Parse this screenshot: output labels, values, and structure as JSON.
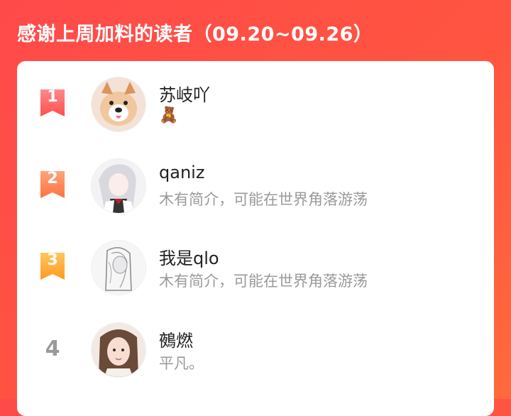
{
  "header": {
    "title": "感谢上周加料的读者（09.20~09.26）"
  },
  "readers": [
    {
      "rank": "1",
      "name": "苏岐吖",
      "bio": "🧸",
      "badge_color": "#ff6a6a"
    },
    {
      "rank": "2",
      "name": "qaniz",
      "bio": "木有简介，可能在世界角落游荡",
      "badge_color": "#ff8a50"
    },
    {
      "rank": "3",
      "name": "我是qlo",
      "bio": "木有简介，可能在世界角落游荡",
      "badge_color": "#ffab2e"
    },
    {
      "rank": "4",
      "name": "鵺燃",
      "bio": "平凡。"
    }
  ]
}
